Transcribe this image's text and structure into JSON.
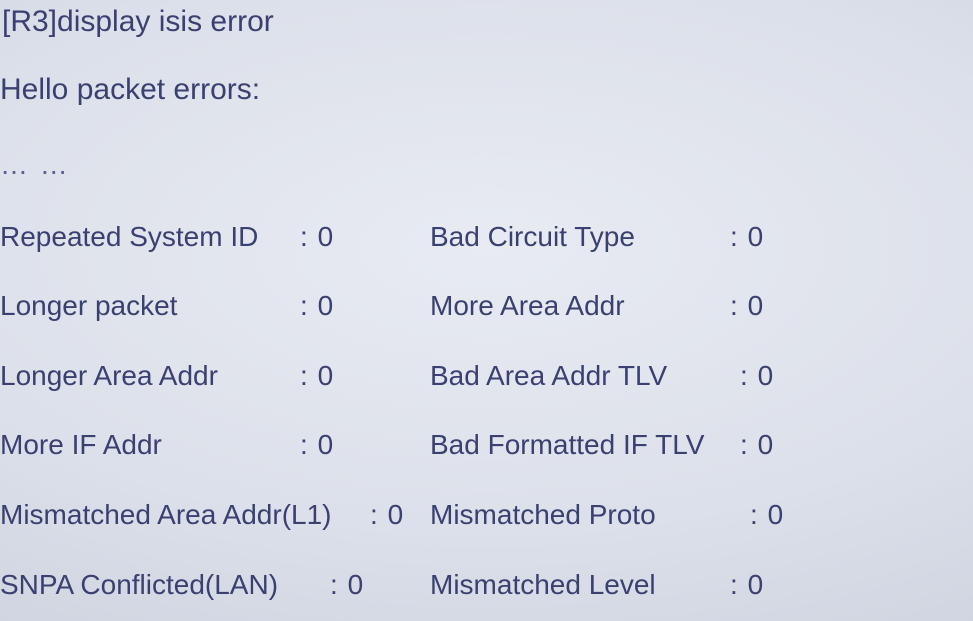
{
  "command": "[R3]display isis error",
  "section": "Hello packet errors:",
  "ellipsis": "… …",
  "rows": [
    {
      "left": {
        "label": "Repeated System ID",
        "sep": ": ",
        "val": "0"
      },
      "right": {
        "label": "Bad Circuit Type",
        "sep": ": ",
        "val": "0"
      }
    },
    {
      "left": {
        "label": "Longer packet",
        "sep": ": ",
        "val": "0"
      },
      "right": {
        "label": "More Area Addr",
        "sep": ": ",
        "val": "0"
      }
    },
    {
      "left": {
        "label": "Longer Area Addr",
        "sep": ": ",
        "val": "0"
      },
      "right": {
        "label": "Bad Area Addr TLV",
        "sep": ": ",
        "val": "0"
      }
    },
    {
      "left": {
        "label": "More IF Addr",
        "sep": ": ",
        "val": "0"
      },
      "right": {
        "label": "Bad Formatted IF TLV",
        "sep": ": ",
        "val": "0"
      }
    },
    {
      "left": {
        "label": "Mismatched Area Addr(L1)",
        "sep": ": ",
        "val": "0"
      },
      "right": {
        "label": "Mismatched Proto",
        "sep": ": ",
        "val": "0"
      }
    },
    {
      "left": {
        "label": "SNPA Conflicted(LAN)",
        "sep": ": ",
        "val": "0"
      },
      "right": {
        "label": "Mismatched Level",
        "sep": ": ",
        "val": "0"
      }
    }
  ]
}
